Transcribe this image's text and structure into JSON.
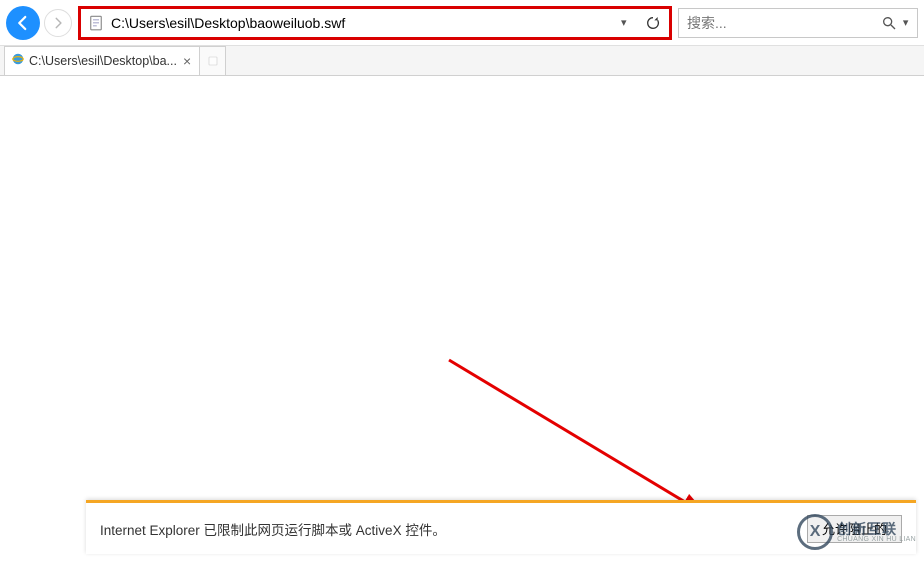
{
  "toolbar": {
    "address": "C:\\Users\\esil\\Desktop\\baoweiluob.swf",
    "search_placeholder": "搜索..."
  },
  "tabs": [
    {
      "label": "C:\\Users\\esil\\Desktop\\ba..."
    }
  ],
  "infobar": {
    "message": "Internet Explorer 已限制此网页运行脚本或 ActiveX 控件。",
    "allow_label": "允许阻止的"
  },
  "watermark": {
    "glyph": "X",
    "cn": "创新互联",
    "en": "CHUANG XIN HU LIAN"
  }
}
